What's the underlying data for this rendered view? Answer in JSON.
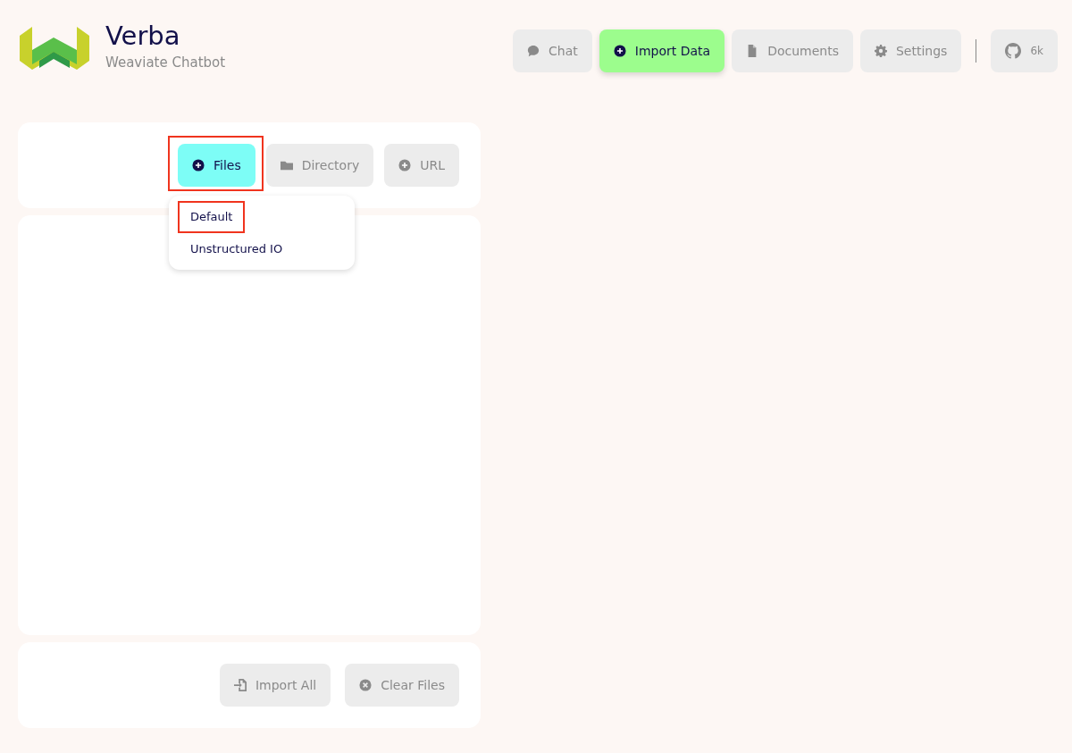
{
  "app": {
    "title": "Verba",
    "subtitle": "Weaviate Chatbot"
  },
  "nav": [
    {
      "label": "Chat",
      "selected": false
    },
    {
      "label": "Import Data",
      "selected": true
    },
    {
      "label": "Documents",
      "selected": false
    },
    {
      "label": "Settings",
      "selected": false
    }
  ],
  "github": {
    "label": "6k"
  },
  "sources": [
    {
      "label": "Files",
      "selected": true,
      "highlighted": true
    },
    {
      "label": "Directory",
      "selected": false,
      "highlighted": false
    },
    {
      "label": "URL",
      "selected": false,
      "highlighted": false
    }
  ],
  "reader_menu": {
    "items": [
      {
        "label": "Default",
        "highlighted": true
      },
      {
        "label": "Unstructured IO",
        "highlighted": false
      }
    ]
  },
  "actions": [
    {
      "label": "Import All"
    },
    {
      "label": "Clear Files"
    }
  ]
}
